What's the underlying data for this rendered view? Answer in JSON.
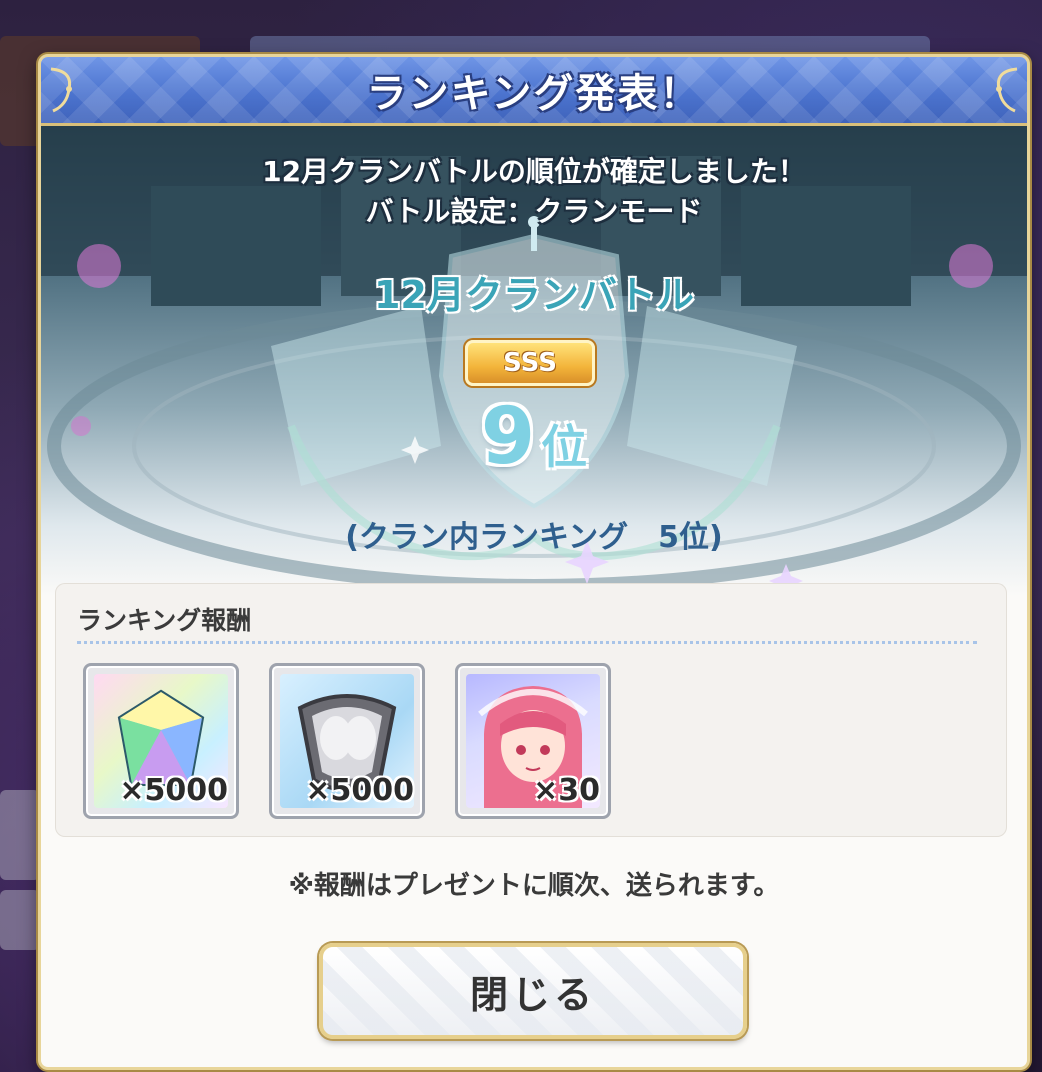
{
  "dialog": {
    "title": "ランキング発表！",
    "message_line1": "12月クランバトルの順位が確定しました！",
    "message_line2": "バトル設定：クランモード",
    "event_name": "12月クランバトル",
    "rank_badge": "SSS",
    "rank_number": "9",
    "rank_unit": "位",
    "clan_rank": "(クラン内ランキング　5位)",
    "reward_title": "ランキング報酬",
    "rewards": [
      {
        "icon": "rainbow-jewel-icon",
        "quantity": "×5000"
      },
      {
        "icon": "clan-coin-icon",
        "quantity": "×5000"
      },
      {
        "icon": "character-memory-piece-icon",
        "quantity": "×30"
      }
    ],
    "notice": "※報酬はプレゼントに順次、送られます。",
    "close_label": "閉じる"
  },
  "colors": {
    "title_bar": "#4c74cf",
    "frame_gold": "#e8d59a",
    "event_name": "#3aa4b7",
    "rank_number": "#7fd1e3",
    "clan_rank_text": "#2f5f8e"
  }
}
